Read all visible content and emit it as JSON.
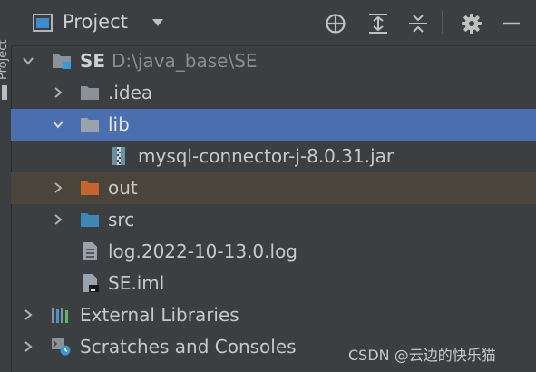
{
  "side_tab": {
    "label": "Project"
  },
  "header": {
    "title": "Project"
  },
  "tree": {
    "root": {
      "name": "SE",
      "path": "D:\\java_base\\SE"
    },
    "idea": {
      "name": ".idea"
    },
    "lib": {
      "name": "lib"
    },
    "jar": {
      "name": "mysql-connector-j-8.0.31.jar"
    },
    "out": {
      "name": "out"
    },
    "src": {
      "name": "src"
    },
    "log": {
      "name": "log.2022-10-13.0.log"
    },
    "iml": {
      "name": "SE.iml"
    },
    "ext": {
      "name": "External Libraries"
    },
    "scratch": {
      "name": "Scratches and Consoles"
    }
  },
  "watermark": "CSDN @云边的快乐猫",
  "colors": {
    "background": "#3c3f41",
    "selection": "#4b6eaf",
    "excluded": "#4a443a",
    "folder": "#8a9197",
    "folder_excluded": "#c8632b",
    "folder_source": "#3a89b5"
  }
}
